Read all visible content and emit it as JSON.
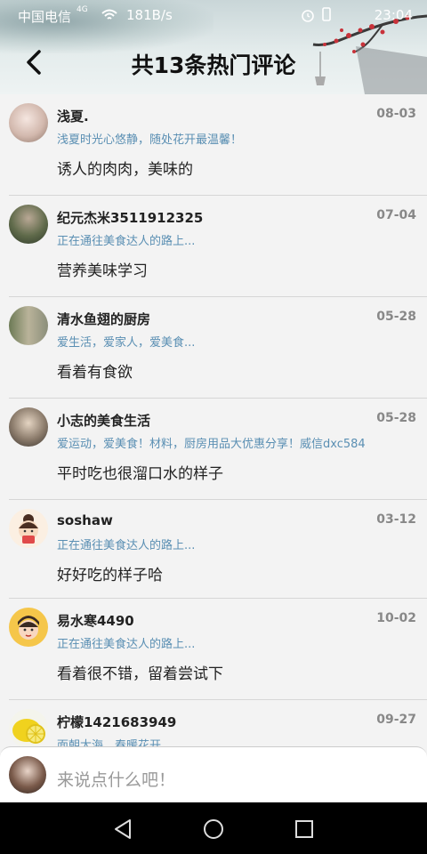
{
  "status_bar": {
    "carrier": "中国电信",
    "network": "4G",
    "speed": "181B/s",
    "time": "23:04"
  },
  "header": {
    "title": "共13条热门评论"
  },
  "comments": [
    {
      "name": "浅夏.",
      "date": "08-03",
      "signature": "浅夏时光心悠静，随处花开最温馨！",
      "text": "诱人的肉肉，美味的",
      "avatar_color": "#e8d6cf"
    },
    {
      "name": "纪元杰米3511912325",
      "date": "07-04",
      "signature": "正在通往美食达人的路上...",
      "text": "营养美味学习",
      "avatar_color": "#7d8a6a"
    },
    {
      "name": "清水鱼翅的厨房",
      "date": "05-28",
      "signature": "爱生活，爱家人，爱美食...",
      "text": "看着有食欲",
      "avatar_color": "#9aa08a"
    },
    {
      "name": "小志的美食生活",
      "date": "05-28",
      "signature": "爱运动，爱美食！材料，厨房用品大优惠分享！威信dxc584",
      "text": "平时吃也很溜口水的样子",
      "avatar_color": "#6b6259"
    },
    {
      "name": "soshaw",
      "date": "03-12",
      "signature": "正在通往美食达人的路上...",
      "text": "好好吃的样子哈",
      "avatar_color": "#f6e7d6"
    },
    {
      "name": "易水寒4490",
      "date": "10-02",
      "signature": "正在通往美食达人的路上...",
      "text": "看着很不错，留着尝试下",
      "avatar_color": "#f5c64a"
    },
    {
      "name": "柠檬1421683949",
      "date": "09-27",
      "signature": "面朝大海，春暖花开",
      "text": "",
      "avatar_color": "#e8d84a"
    }
  ],
  "input": {
    "placeholder": "来说点什么吧！"
  }
}
